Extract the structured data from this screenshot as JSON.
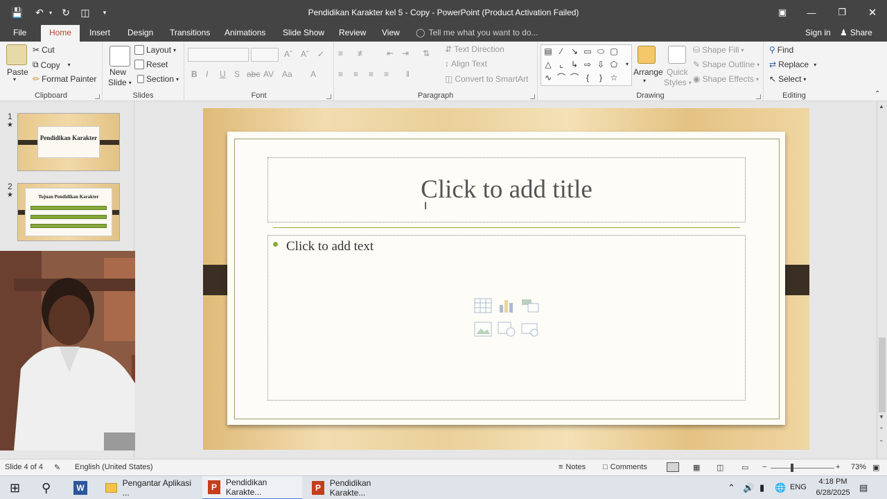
{
  "window": {
    "title": "Pendidikan Karakter kel 5 - Copy - PowerPoint (Product Activation Failed)"
  },
  "tabs": [
    {
      "label": "File"
    },
    {
      "label": "Home"
    },
    {
      "label": "Insert"
    },
    {
      "label": "Design"
    },
    {
      "label": "Transitions"
    },
    {
      "label": "Animations"
    },
    {
      "label": "Slide Show"
    },
    {
      "label": "Review"
    },
    {
      "label": "View"
    }
  ],
  "tell_me": {
    "placeholder": "Tell me what you want to do..."
  },
  "account": {
    "sign_in": "Sign in",
    "share": "Share"
  },
  "ribbon": {
    "clipboard": {
      "label": "Clipboard",
      "paste": "Paste",
      "cut": "Cut",
      "copy": "Copy",
      "format_painter": "Format Painter"
    },
    "slides": {
      "label": "Slides",
      "new_slide": "New",
      "new_slide2": "Slide",
      "layout": "Layout",
      "reset": "Reset",
      "section": "Section"
    },
    "font": {
      "label": "Font"
    },
    "paragraph": {
      "label": "Paragraph",
      "text_direction": "Text Direction",
      "align_text": "Align Text",
      "smartart": "Convert to SmartArt"
    },
    "drawing": {
      "label": "Drawing",
      "arrange": "Arrange",
      "quick": "Quick",
      "styles": "Styles",
      "shape_fill": "Shape Fill",
      "shape_outline": "Shape Outline",
      "shape_effects": "Shape Effects"
    },
    "editing": {
      "label": "Editing",
      "find": "Find",
      "replace": "Replace",
      "select": "Select"
    }
  },
  "thumbnails": [
    {
      "number": "1",
      "title": "Pendidikan Karakter"
    },
    {
      "number": "2",
      "title": "Tujuan Pendidikan Karakter"
    }
  ],
  "slide": {
    "title_placeholder": "Click to add title",
    "body_placeholder": "Click to add text"
  },
  "status": {
    "slide_info": "Slide 4 of 4",
    "language": "English (United States)",
    "notes": "Notes",
    "comments": "Comments",
    "zoom": "73%"
  },
  "taskbar": {
    "items": [
      {
        "label": "Pengantar Aplikasi ..."
      },
      {
        "label": "Pendidikan Karakte..."
      },
      {
        "label": "Pendidikan Karakte..."
      }
    ],
    "lang": "ENG",
    "time": "4:18 PM",
    "date": "6/28/2025"
  },
  "colors": {
    "titlebar": "#444444",
    "accent": "#b7472a",
    "bullet": "#8aab3a"
  }
}
